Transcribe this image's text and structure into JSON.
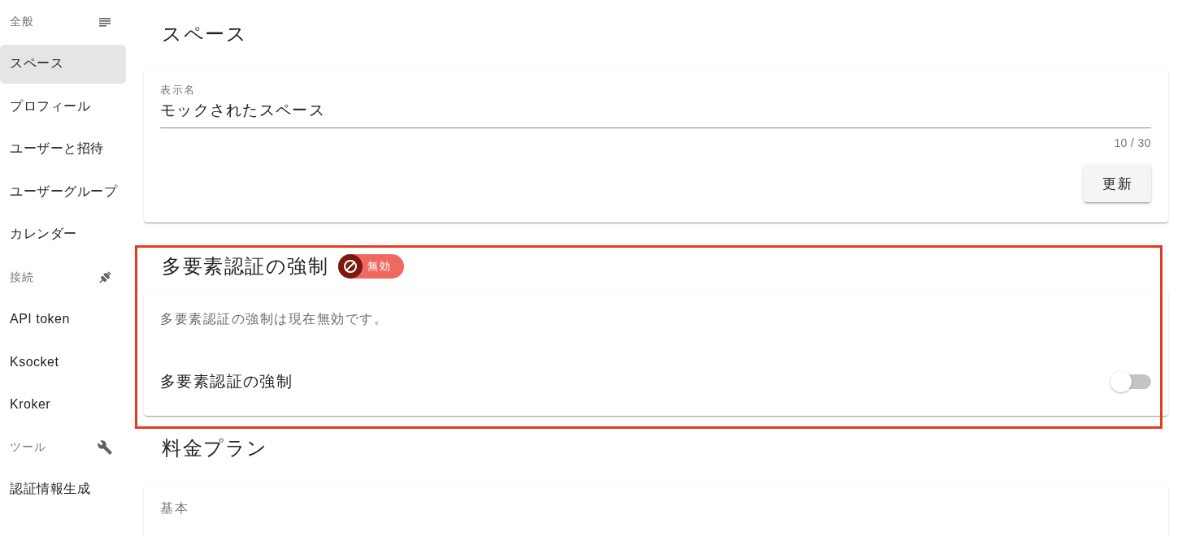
{
  "sidebar": {
    "sections": [
      {
        "title": "全般",
        "items": [
          {
            "label": "スペース",
            "selected": true
          },
          {
            "label": "プロフィール",
            "selected": false
          },
          {
            "label": "ユーザーと招待",
            "selected": false
          },
          {
            "label": "ユーザーグループ",
            "selected": false
          },
          {
            "label": "カレンダー",
            "selected": false
          }
        ]
      },
      {
        "title": "接続",
        "items": [
          {
            "label": "API token",
            "selected": false
          },
          {
            "label": "Ksocket",
            "selected": false
          },
          {
            "label": "Kroker",
            "selected": false
          }
        ]
      },
      {
        "title": "ツール",
        "items": [
          {
            "label": "認証情報生成",
            "selected": false
          }
        ]
      }
    ]
  },
  "space": {
    "title": "スペース",
    "display_name_field": {
      "label": "表示名",
      "value": "モックされたスペース",
      "counter": "10 / 30"
    },
    "update_button": "更新"
  },
  "mfa": {
    "title": "多要素認証の強制",
    "highlighted": true,
    "status_badge": {
      "label": "無効",
      "enabled": false
    },
    "description": "多要素認証の強制は現在無効です。",
    "toggle": {
      "label": "多要素認証の強制",
      "on": false
    }
  },
  "billing": {
    "title": "料金プラン",
    "plan_label": "基本"
  }
}
